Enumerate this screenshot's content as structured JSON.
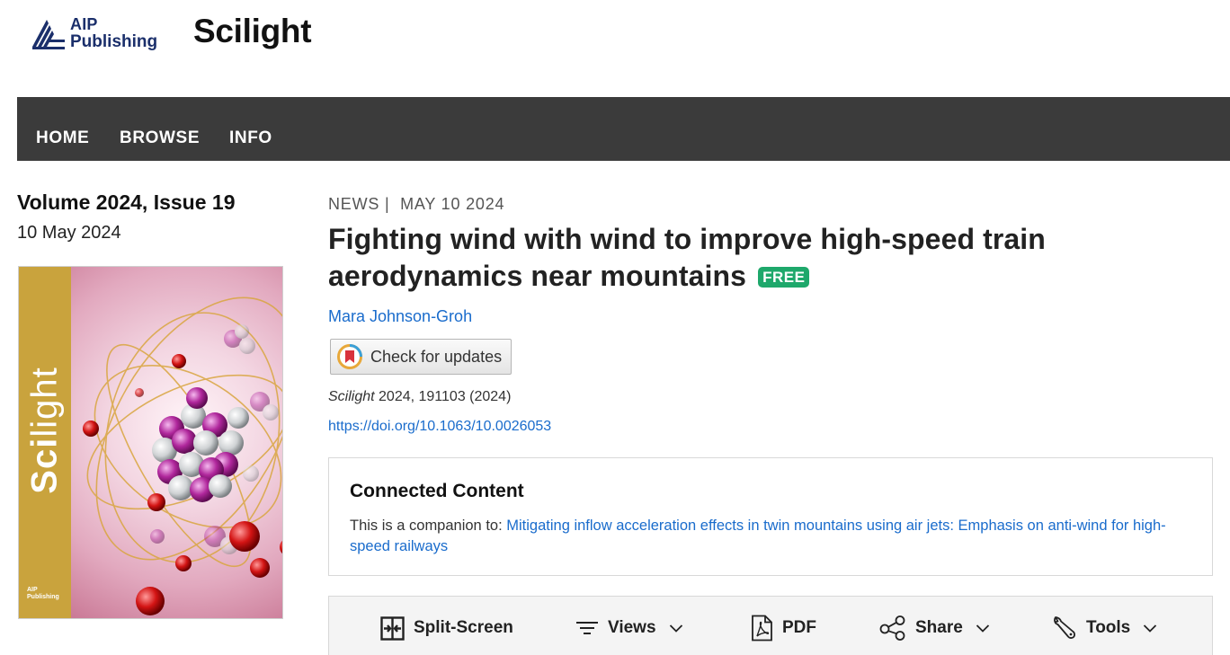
{
  "header": {
    "publisher_logo_line1": "AIP",
    "publisher_logo_line2": "Publishing",
    "site_title": "Scilight"
  },
  "nav": {
    "items": [
      {
        "label": "HOME"
      },
      {
        "label": "BROWSE"
      },
      {
        "label": "INFO"
      }
    ]
  },
  "issue": {
    "title": "Volume 2024, Issue 19",
    "date": "10 May 2024",
    "cover": {
      "band_title_prefix": "Sci",
      "band_title_rest": "light",
      "mini_logo_line1": "AIP",
      "mini_logo_line2": "Publishing",
      "band_color": "#c9a33d"
    }
  },
  "article": {
    "section": "NEWS",
    "separator": "|",
    "date": "MAY 10 2024",
    "title": "Fighting wind with wind to improve high-speed train aerodynamics near mountains",
    "free_badge": "FREE",
    "author": "Mara Johnson-Groh",
    "check_updates_label": "Check for updates",
    "citation_journal": "Scilight",
    "citation_rest": " 2024, 191103 (2024)",
    "doi": "https://doi.org/10.1063/10.0026053"
  },
  "connected_content": {
    "heading": "Connected Content",
    "prefix": "This is a companion to: ",
    "link_text": "Mitigating inflow acceleration effects in twin mountains using air jets: Emphasis on anti-wind for high-speed railways"
  },
  "toolbar": {
    "split_screen": "Split-Screen",
    "views": "Views",
    "pdf": "PDF",
    "share": "Share",
    "tools": "Tools"
  },
  "colors": {
    "nav_background": "#3b3b3b",
    "link": "#1a6ccc",
    "free_badge": "#1ea86b",
    "logo_navy": "#1b2f6b"
  },
  "icons": [
    "aip-logo-icon",
    "crossmark-icon",
    "split-screen-icon",
    "views-lines-icon",
    "chevron-down-icon",
    "pdf-icon",
    "share-icon",
    "tools-wrench-icon"
  ]
}
